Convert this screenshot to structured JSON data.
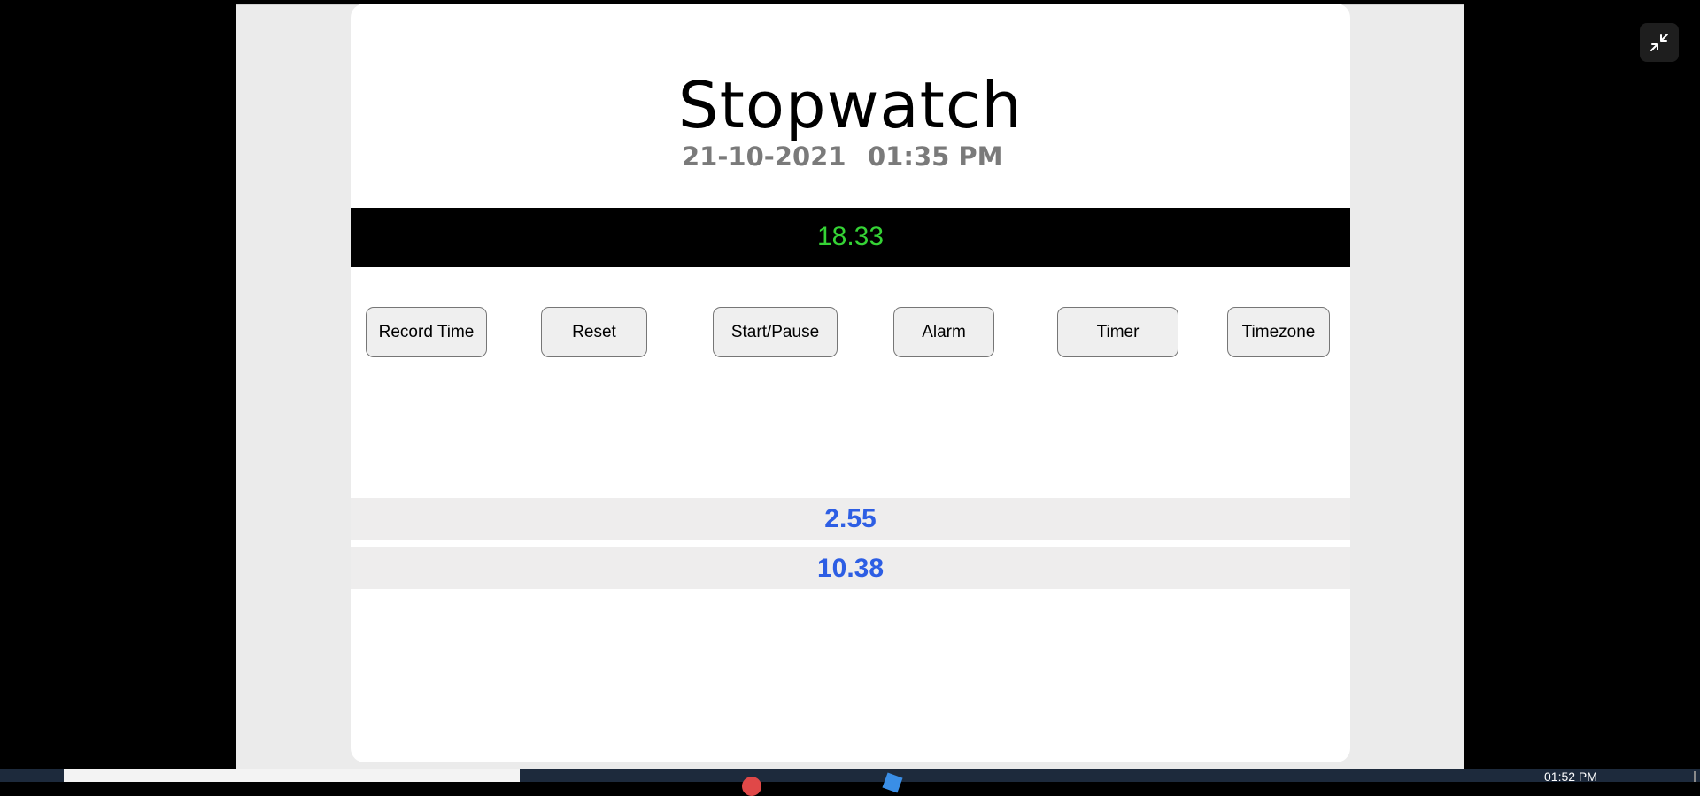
{
  "app": {
    "title": "Stopwatch",
    "date": "21-10-2021",
    "time": "01:35 PM"
  },
  "display": {
    "value": "18.33"
  },
  "buttons": {
    "record": "Record Time",
    "reset": "Reset",
    "start_pause": "Start/Pause",
    "alarm": "Alarm",
    "timer": "Timer",
    "timezone": "Timezone"
  },
  "laps": [
    "2.55",
    "10.38"
  ],
  "window": {
    "exit_fullscreen_icon": "exit-fullscreen-icon"
  },
  "taskbar": {
    "clock": "01:52 PM"
  },
  "colors": {
    "display_text": "#35d335",
    "lap_text": "#2d5ee4",
    "date_text": "#7a7a7a"
  }
}
